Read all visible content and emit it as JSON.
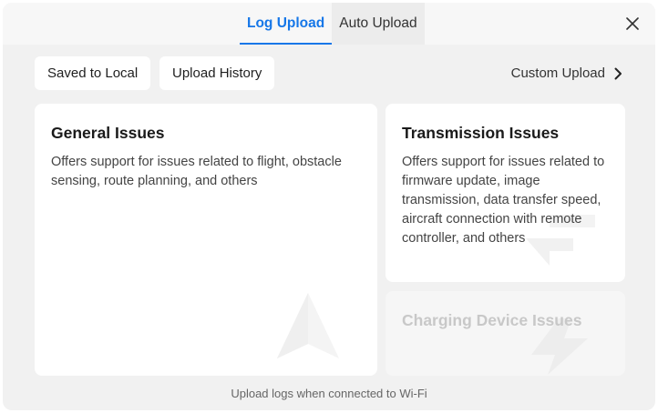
{
  "tabs": [
    {
      "label": "Log Upload",
      "active": true
    },
    {
      "label": "Auto Upload",
      "active": false
    }
  ],
  "toolbar": {
    "saved_local_label": "Saved to Local",
    "upload_history_label": "Upload History",
    "custom_upload_label": "Custom Upload"
  },
  "cards": {
    "general": {
      "title": "General Issues",
      "description": "Offers support for issues related to flight, obstacle sensing, route planning, and others"
    },
    "transmission": {
      "title": "Transmission Issues",
      "description": "Offers support for issues related to firmware update, image transmission, data transfer speed, aircraft connection with remote controller, and others"
    },
    "charging": {
      "title": "Charging Device Issues",
      "disabled": true
    }
  },
  "footer": {
    "note": "Upload logs when connected to Wi-Fi"
  },
  "icons": {
    "close": "close-icon",
    "custom_upload_chevron": "chevron-right-icon",
    "general_watermark": "arrow-navigation-icon",
    "transmission_watermark": "transfer-arrows-icon",
    "charging_watermark": "lightning-bolt-icon"
  },
  "colors": {
    "accent": "#1677e8",
    "panel_bg": "#f1f1f1",
    "card_bg": "#ffffff",
    "disabled_text": "#c8c8c8"
  }
}
